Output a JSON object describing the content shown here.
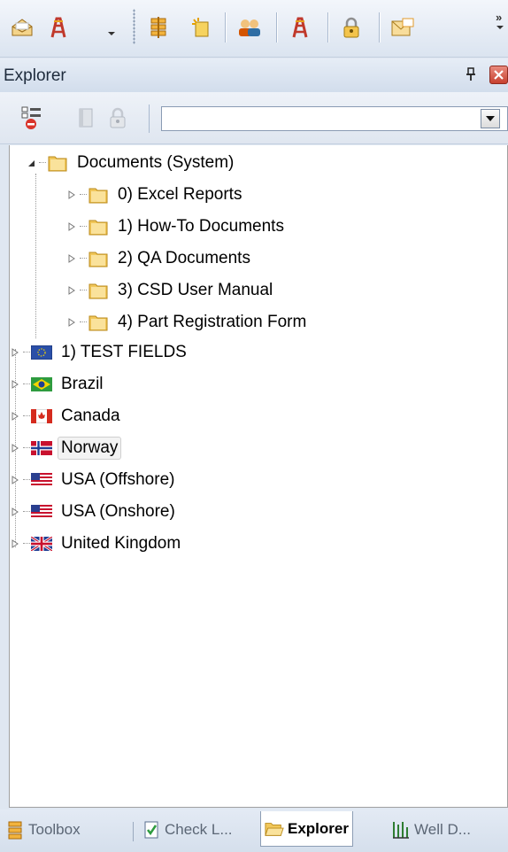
{
  "toolbar": {
    "buttons": [
      {
        "name": "envelope-open-icon",
        "color": "#e0a23a"
      },
      {
        "name": "rig-red-icon",
        "color": "#c0392b"
      },
      {
        "name": "rig-stack-icon",
        "color": "#e8a21d"
      },
      {
        "name": "new-item-icon",
        "color": "#e7c24a"
      },
      {
        "name": "users-icon",
        "color": "#d35400"
      },
      {
        "name": "rig-icon",
        "color": "#c0392b"
      },
      {
        "name": "lock-icon",
        "color": "#d9a521"
      },
      {
        "name": "mail-icon",
        "color": "#e0a23a"
      }
    ],
    "overflow_glyph": "»"
  },
  "panel": {
    "title": "Explorer",
    "filter": {
      "value": "",
      "placeholder": ""
    }
  },
  "tree": {
    "root": {
      "label": "Documents (System)",
      "expanded": true,
      "icon": "folder-icon"
    },
    "root_children": [
      {
        "label": "0) Excel Reports",
        "icon": "folder-icon"
      },
      {
        "label": "1) How-To Documents",
        "icon": "folder-icon"
      },
      {
        "label": "2) QA Documents",
        "icon": "folder-icon"
      },
      {
        "label": "3) CSD User Manual",
        "icon": "folder-icon"
      },
      {
        "label": "4) Part Registration Form",
        "icon": "folder-icon"
      }
    ],
    "top_level": [
      {
        "label": "1) TEST FIELDS",
        "icon": "eu-flag-icon"
      },
      {
        "label": "Brazil",
        "icon": "brazil-flag-icon"
      },
      {
        "label": "Canada",
        "icon": "canada-flag-icon"
      },
      {
        "label": "Norway",
        "icon": "norway-flag-icon",
        "hovered": true
      },
      {
        "label": "USA (Offshore)",
        "icon": "usa-flag-icon"
      },
      {
        "label": "USA (Onshore)",
        "icon": "usa-flag-icon"
      },
      {
        "label": "United Kingdom",
        "icon": "uk-flag-icon"
      }
    ]
  },
  "bottom_tabs": [
    {
      "label": "Toolbox",
      "icon": "toolbox-icon",
      "active": false
    },
    {
      "label": "Check L...",
      "icon": "checklist-icon",
      "active": false
    },
    {
      "label": "Explorer",
      "icon": "open-folder-icon",
      "active": true
    },
    {
      "label": "Well D...",
      "icon": "well-icon",
      "active": false
    }
  ]
}
